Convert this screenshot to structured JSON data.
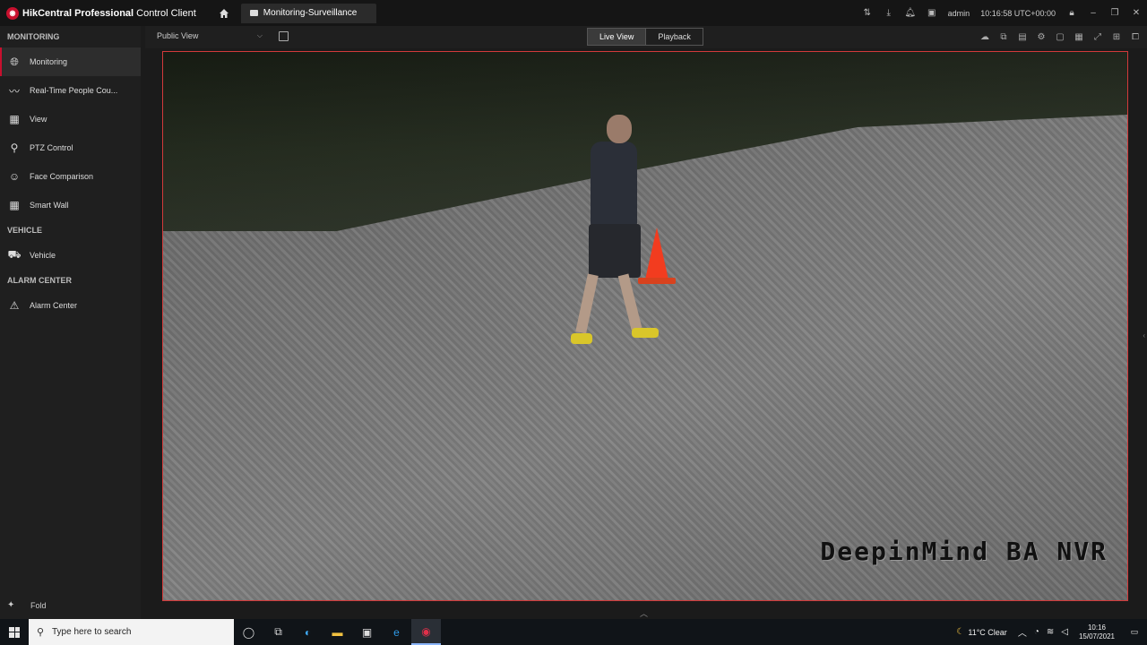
{
  "app": {
    "title_bold": "HikCentral Professional",
    "title_rest": "Control Client",
    "tab_label": "Monitoring-Surveillance",
    "user": "admin",
    "time": "10:16:58 UTC+00:00"
  },
  "sidebar": {
    "sections": [
      {
        "header": "MONITORING",
        "items": [
          {
            "label": "Monitoring",
            "icon": "globe-icon"
          },
          {
            "label": "Real-Time People Cou...",
            "icon": "pulse-icon"
          },
          {
            "label": "View",
            "icon": "grid-icon"
          },
          {
            "label": "PTZ Control",
            "icon": "ptz-icon"
          },
          {
            "label": "Face Comparison",
            "icon": "face-icon"
          },
          {
            "label": "Smart Wall",
            "icon": "wall-icon"
          }
        ]
      },
      {
        "header": "VEHICLE",
        "items": [
          {
            "label": "Vehicle",
            "icon": "vehicle-icon"
          }
        ]
      },
      {
        "header": "ALARM CENTER",
        "items": [
          {
            "label": "Alarm Center",
            "icon": "alarm-icon"
          }
        ]
      }
    ],
    "fold_label": "Fold"
  },
  "toolbar": {
    "view_select": "Public View",
    "live_view": "Live View",
    "playback": "Playback"
  },
  "video": {
    "osd_text": "DeepinMind BA NVR"
  },
  "taskbar": {
    "search_placeholder": "Type here to search",
    "weather": "11°C  Clear",
    "clock_time": "10:16",
    "clock_date": "15/07/2021"
  }
}
